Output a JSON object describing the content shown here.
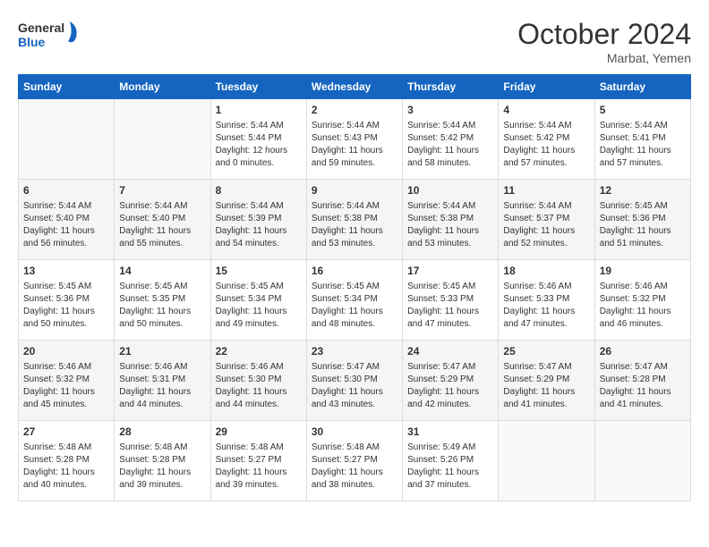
{
  "header": {
    "logo_line1": "General",
    "logo_line2": "Blue",
    "month": "October 2024",
    "location": "Marbat, Yemen"
  },
  "days_of_week": [
    "Sunday",
    "Monday",
    "Tuesday",
    "Wednesday",
    "Thursday",
    "Friday",
    "Saturday"
  ],
  "weeks": [
    [
      {
        "day": "",
        "content": ""
      },
      {
        "day": "",
        "content": ""
      },
      {
        "day": "1",
        "content": "Sunrise: 5:44 AM\nSunset: 5:44 PM\nDaylight: 12 hours and 0 minutes."
      },
      {
        "day": "2",
        "content": "Sunrise: 5:44 AM\nSunset: 5:43 PM\nDaylight: 11 hours and 59 minutes."
      },
      {
        "day": "3",
        "content": "Sunrise: 5:44 AM\nSunset: 5:42 PM\nDaylight: 11 hours and 58 minutes."
      },
      {
        "day": "4",
        "content": "Sunrise: 5:44 AM\nSunset: 5:42 PM\nDaylight: 11 hours and 57 minutes."
      },
      {
        "day": "5",
        "content": "Sunrise: 5:44 AM\nSunset: 5:41 PM\nDaylight: 11 hours and 57 minutes."
      }
    ],
    [
      {
        "day": "6",
        "content": "Sunrise: 5:44 AM\nSunset: 5:40 PM\nDaylight: 11 hours and 56 minutes."
      },
      {
        "day": "7",
        "content": "Sunrise: 5:44 AM\nSunset: 5:40 PM\nDaylight: 11 hours and 55 minutes."
      },
      {
        "day": "8",
        "content": "Sunrise: 5:44 AM\nSunset: 5:39 PM\nDaylight: 11 hours and 54 minutes."
      },
      {
        "day": "9",
        "content": "Sunrise: 5:44 AM\nSunset: 5:38 PM\nDaylight: 11 hours and 53 minutes."
      },
      {
        "day": "10",
        "content": "Sunrise: 5:44 AM\nSunset: 5:38 PM\nDaylight: 11 hours and 53 minutes."
      },
      {
        "day": "11",
        "content": "Sunrise: 5:44 AM\nSunset: 5:37 PM\nDaylight: 11 hours and 52 minutes."
      },
      {
        "day": "12",
        "content": "Sunrise: 5:45 AM\nSunset: 5:36 PM\nDaylight: 11 hours and 51 minutes."
      }
    ],
    [
      {
        "day": "13",
        "content": "Sunrise: 5:45 AM\nSunset: 5:36 PM\nDaylight: 11 hours and 50 minutes."
      },
      {
        "day": "14",
        "content": "Sunrise: 5:45 AM\nSunset: 5:35 PM\nDaylight: 11 hours and 50 minutes."
      },
      {
        "day": "15",
        "content": "Sunrise: 5:45 AM\nSunset: 5:34 PM\nDaylight: 11 hours and 49 minutes."
      },
      {
        "day": "16",
        "content": "Sunrise: 5:45 AM\nSunset: 5:34 PM\nDaylight: 11 hours and 48 minutes."
      },
      {
        "day": "17",
        "content": "Sunrise: 5:45 AM\nSunset: 5:33 PM\nDaylight: 11 hours and 47 minutes."
      },
      {
        "day": "18",
        "content": "Sunrise: 5:46 AM\nSunset: 5:33 PM\nDaylight: 11 hours and 47 minutes."
      },
      {
        "day": "19",
        "content": "Sunrise: 5:46 AM\nSunset: 5:32 PM\nDaylight: 11 hours and 46 minutes."
      }
    ],
    [
      {
        "day": "20",
        "content": "Sunrise: 5:46 AM\nSunset: 5:32 PM\nDaylight: 11 hours and 45 minutes."
      },
      {
        "day": "21",
        "content": "Sunrise: 5:46 AM\nSunset: 5:31 PM\nDaylight: 11 hours and 44 minutes."
      },
      {
        "day": "22",
        "content": "Sunrise: 5:46 AM\nSunset: 5:30 PM\nDaylight: 11 hours and 44 minutes."
      },
      {
        "day": "23",
        "content": "Sunrise: 5:47 AM\nSunset: 5:30 PM\nDaylight: 11 hours and 43 minutes."
      },
      {
        "day": "24",
        "content": "Sunrise: 5:47 AM\nSunset: 5:29 PM\nDaylight: 11 hours and 42 minutes."
      },
      {
        "day": "25",
        "content": "Sunrise: 5:47 AM\nSunset: 5:29 PM\nDaylight: 11 hours and 41 minutes."
      },
      {
        "day": "26",
        "content": "Sunrise: 5:47 AM\nSunset: 5:28 PM\nDaylight: 11 hours and 41 minutes."
      }
    ],
    [
      {
        "day": "27",
        "content": "Sunrise: 5:48 AM\nSunset: 5:28 PM\nDaylight: 11 hours and 40 minutes."
      },
      {
        "day": "28",
        "content": "Sunrise: 5:48 AM\nSunset: 5:28 PM\nDaylight: 11 hours and 39 minutes."
      },
      {
        "day": "29",
        "content": "Sunrise: 5:48 AM\nSunset: 5:27 PM\nDaylight: 11 hours and 39 minutes."
      },
      {
        "day": "30",
        "content": "Sunrise: 5:48 AM\nSunset: 5:27 PM\nDaylight: 11 hours and 38 minutes."
      },
      {
        "day": "31",
        "content": "Sunrise: 5:49 AM\nSunset: 5:26 PM\nDaylight: 11 hours and 37 minutes."
      },
      {
        "day": "",
        "content": ""
      },
      {
        "day": "",
        "content": ""
      }
    ]
  ]
}
